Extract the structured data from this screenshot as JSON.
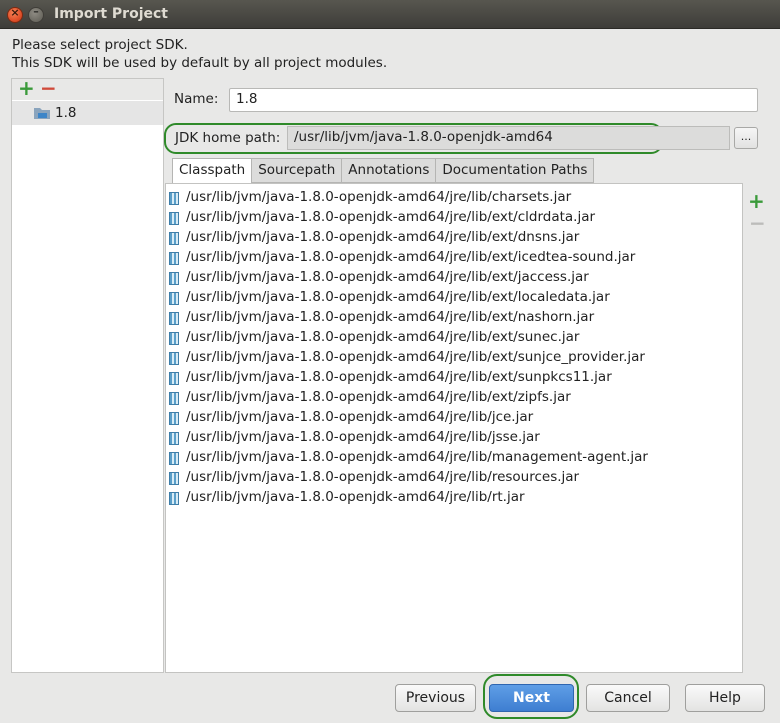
{
  "window": {
    "title": "Import Project"
  },
  "intro": {
    "line1": "Please select project SDK.",
    "line2": "This SDK will be used by default by all project modules."
  },
  "sdk_list": {
    "add_symbol": "+",
    "remove_symbol": "−",
    "items": [
      {
        "label": "1.8"
      }
    ]
  },
  "form": {
    "name_label": "Name:",
    "name_value": "1.8",
    "jdk_label": "JDK home path:",
    "jdk_value": "/usr/lib/jvm/java-1.8.0-openjdk-amd64",
    "browse_label": "..."
  },
  "tabs": [
    {
      "label": "Classpath",
      "active": true
    },
    {
      "label": "Sourcepath",
      "active": false
    },
    {
      "label": "Annotations",
      "active": false
    },
    {
      "label": "Documentation Paths",
      "active": false
    }
  ],
  "classpath": [
    "/usr/lib/jvm/java-1.8.0-openjdk-amd64/jre/lib/charsets.jar",
    "/usr/lib/jvm/java-1.8.0-openjdk-amd64/jre/lib/ext/cldrdata.jar",
    "/usr/lib/jvm/java-1.8.0-openjdk-amd64/jre/lib/ext/dnsns.jar",
    "/usr/lib/jvm/java-1.8.0-openjdk-amd64/jre/lib/ext/icedtea-sound.jar",
    "/usr/lib/jvm/java-1.8.0-openjdk-amd64/jre/lib/ext/jaccess.jar",
    "/usr/lib/jvm/java-1.8.0-openjdk-amd64/jre/lib/ext/localedata.jar",
    "/usr/lib/jvm/java-1.8.0-openjdk-amd64/jre/lib/ext/nashorn.jar",
    "/usr/lib/jvm/java-1.8.0-openjdk-amd64/jre/lib/ext/sunec.jar",
    "/usr/lib/jvm/java-1.8.0-openjdk-amd64/jre/lib/ext/sunjce_provider.jar",
    "/usr/lib/jvm/java-1.8.0-openjdk-amd64/jre/lib/ext/sunpkcs11.jar",
    "/usr/lib/jvm/java-1.8.0-openjdk-amd64/jre/lib/ext/zipfs.jar",
    "/usr/lib/jvm/java-1.8.0-openjdk-amd64/jre/lib/jce.jar",
    "/usr/lib/jvm/java-1.8.0-openjdk-amd64/jre/lib/jsse.jar",
    "/usr/lib/jvm/java-1.8.0-openjdk-amd64/jre/lib/management-agent.jar",
    "/usr/lib/jvm/java-1.8.0-openjdk-amd64/jre/lib/resources.jar",
    "/usr/lib/jvm/java-1.8.0-openjdk-amd64/jre/lib/rt.jar"
  ],
  "path_tools": {
    "add_symbol": "+",
    "remove_symbol": "−"
  },
  "buttons": {
    "previous": "Previous",
    "next": "Next",
    "cancel": "Cancel",
    "help": "Help"
  },
  "colors": {
    "accent": "#3e7ed1",
    "highlight": "#2f8a2a",
    "add": "#3a9a3a",
    "remove": "#d04a3a"
  }
}
